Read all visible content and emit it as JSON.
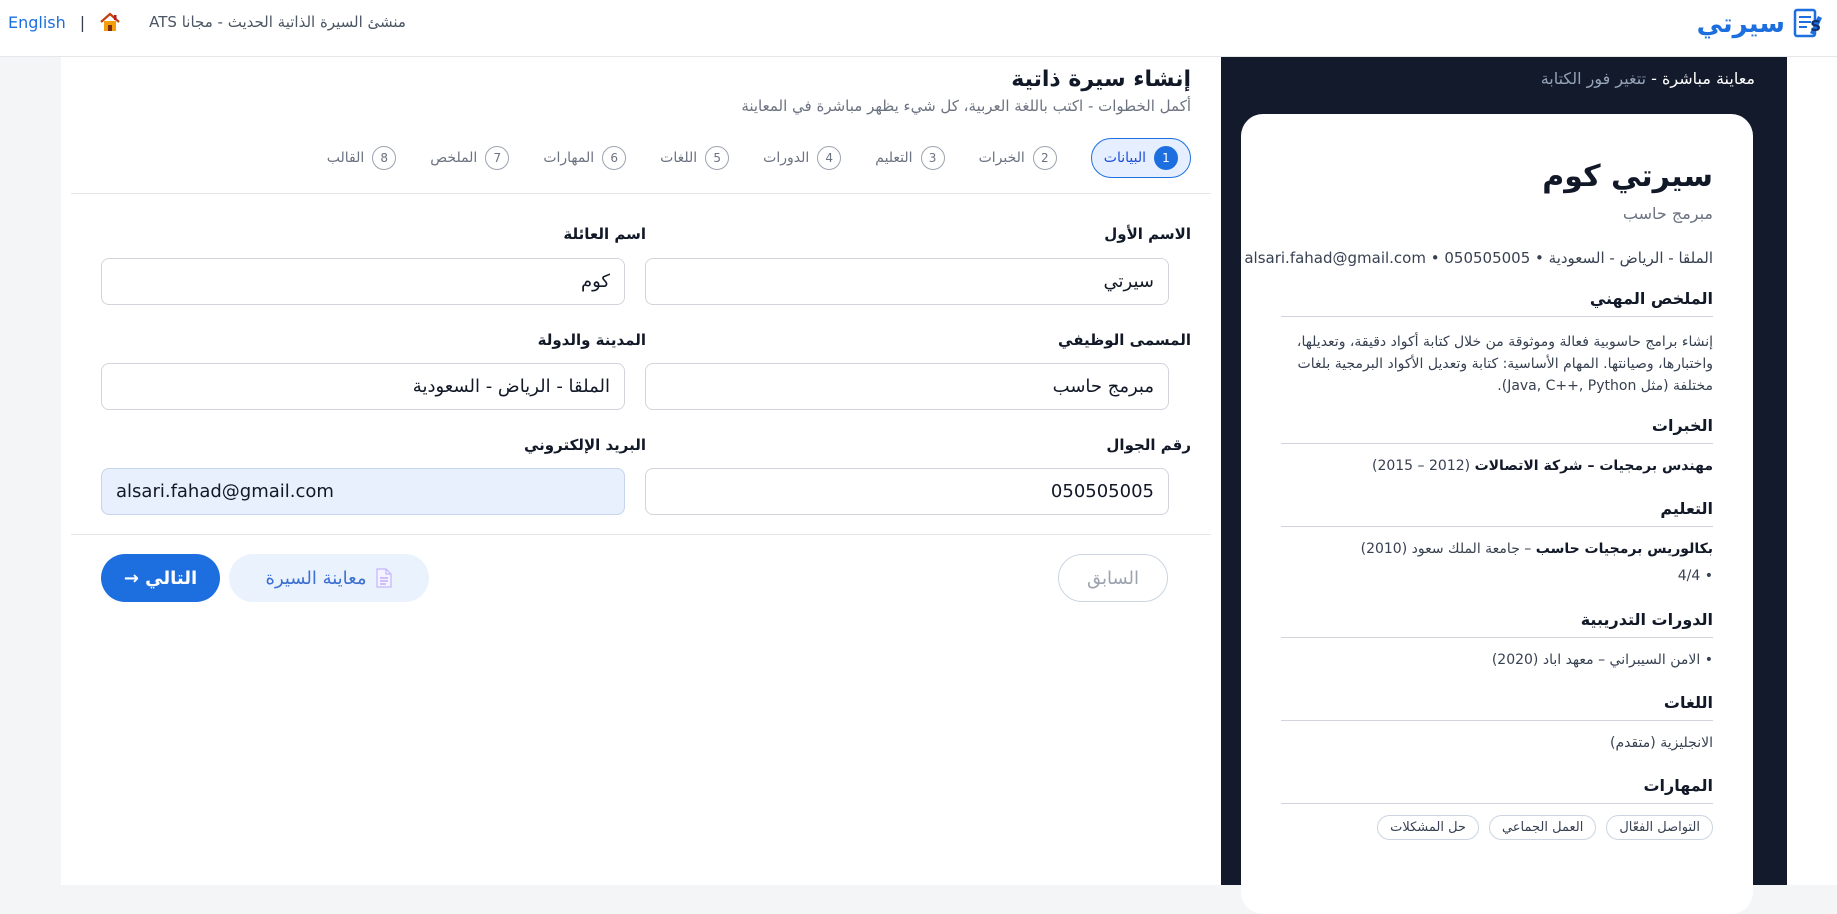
{
  "header": {
    "brand_name": "سيرتي",
    "brand_mark": "S",
    "lang_link": "English",
    "separator": "|",
    "site_title": "ATS منشئ السيرة الذاتية الحديث - مجانا"
  },
  "form": {
    "title": "إنشاء سيرة ذاتية",
    "subtitle": "أكمل الخطوات - اكتب باللغة العربية، كل شيء يظهر مباشرة في المعاينة",
    "steps": [
      {
        "num": "1",
        "label": "البيانات",
        "active": true
      },
      {
        "num": "2",
        "label": "الخبرات"
      },
      {
        "num": "3",
        "label": "التعليم"
      },
      {
        "num": "4",
        "label": "الدورات"
      },
      {
        "num": "5",
        "label": "اللغات"
      },
      {
        "num": "6",
        "label": "المهارات"
      },
      {
        "num": "7",
        "label": "الملخص"
      },
      {
        "num": "8",
        "label": "القالب"
      }
    ],
    "fields": {
      "first_name": {
        "label": "الاسم الأول",
        "value": "سيرتي"
      },
      "last_name": {
        "label": "اسم العائلة",
        "value": "كوم"
      },
      "job_title": {
        "label": "المسمى الوظيفي",
        "value": "مبرمج حاسب"
      },
      "city_country": {
        "label": "المدينة والدولة",
        "value": "الملقا - الرياض - السعودية"
      },
      "phone": {
        "label": "رقم الجوال",
        "value": "050505005"
      },
      "email": {
        "label": "البريد الإلكتروني",
        "value": "alsari.fahad@gmail.com"
      }
    },
    "buttons": {
      "prev": "السابق",
      "preview": "معاينة السيرة",
      "next": "التالي →"
    }
  },
  "preview": {
    "header_title": "معاينة مباشرة",
    "header_dash": " - ",
    "header_hint": "تتغير فور الكتابة",
    "cv": {
      "name": "سيرتي كوم",
      "role": "مبرمج حاسب",
      "contact": "الملقا - الرياض - السعودية • 050505005 • alsari.fahad@gmail.com",
      "summary_heading": "الملخص المهني",
      "summary_text": "إنشاء برامج حاسوبية فعالة وموثوقة من خلال كتابة أكواد دقيقة، وتعديلها، واختبارها، وصيانتها. المهام الأساسية: كتابة وتعديل الأكواد البرمجية بلغات مختلفة (مثل Java, C++, Python).",
      "experience_heading": "الخبرات",
      "experience_title": "مهندس برمجيات – شركة الاتصالات",
      "experience_years": "(2012 – 2015)",
      "education_heading": "التعليم",
      "education_title": "بكالوريس برمجيات حاسب",
      "education_detail": " – جامعة الملك سعود (2010)",
      "education_gpa": "• 4/4",
      "courses_heading": "الدورات التدريبية",
      "course_item": "• الامن السيبراني – معهد اباد (2020)",
      "languages_heading": "اللغات",
      "language_item": "الانجليزية (متقدم)",
      "skills_heading": "المهارات",
      "skills": [
        "حل المشكلات",
        "العمل الجماعي",
        "التواصل الفعّال"
      ]
    }
  },
  "colors": {
    "accent": "#1d6fe0",
    "preview_bg": "#131a2b",
    "active_step_bg": "#e6efff"
  },
  "icons": {
    "brand": "cv-document-pen-icon",
    "home": "home-icon",
    "preview_button": "document-icon"
  }
}
